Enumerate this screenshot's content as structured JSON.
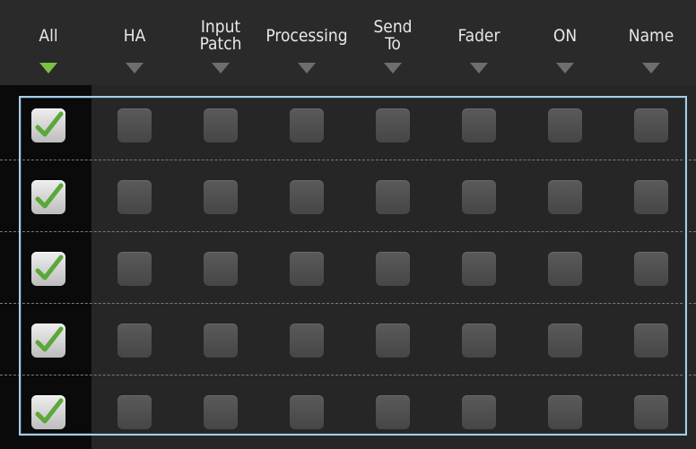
{
  "columns": [
    {
      "key": "all",
      "label": "All",
      "active": true
    },
    {
      "key": "ha",
      "label": "HA",
      "active": false
    },
    {
      "key": "input_patch",
      "label": "Input\nPatch",
      "active": false
    },
    {
      "key": "processing",
      "label": "Processing",
      "active": false
    },
    {
      "key": "send_to",
      "label": "Send\nTo",
      "active": false
    },
    {
      "key": "fader",
      "label": "Fader",
      "active": false
    },
    {
      "key": "on",
      "label": "ON",
      "active": false
    },
    {
      "key": "name",
      "label": "Name",
      "active": false
    }
  ],
  "rows": [
    [
      true,
      false,
      false,
      false,
      false,
      false,
      false,
      false
    ],
    [
      true,
      false,
      false,
      false,
      false,
      false,
      false,
      false
    ],
    [
      true,
      false,
      false,
      false,
      false,
      false,
      false,
      false
    ],
    [
      true,
      false,
      false,
      false,
      false,
      false,
      false,
      false
    ],
    [
      true,
      false,
      false,
      false,
      false,
      false,
      false,
      false
    ]
  ],
  "colors": {
    "accent": "#7cc142",
    "selection_frame": "#a8cde6",
    "checkmark": "#5aa83a"
  },
  "icons": {
    "sort": "triangle-down-icon",
    "check": "checkmark-icon"
  }
}
